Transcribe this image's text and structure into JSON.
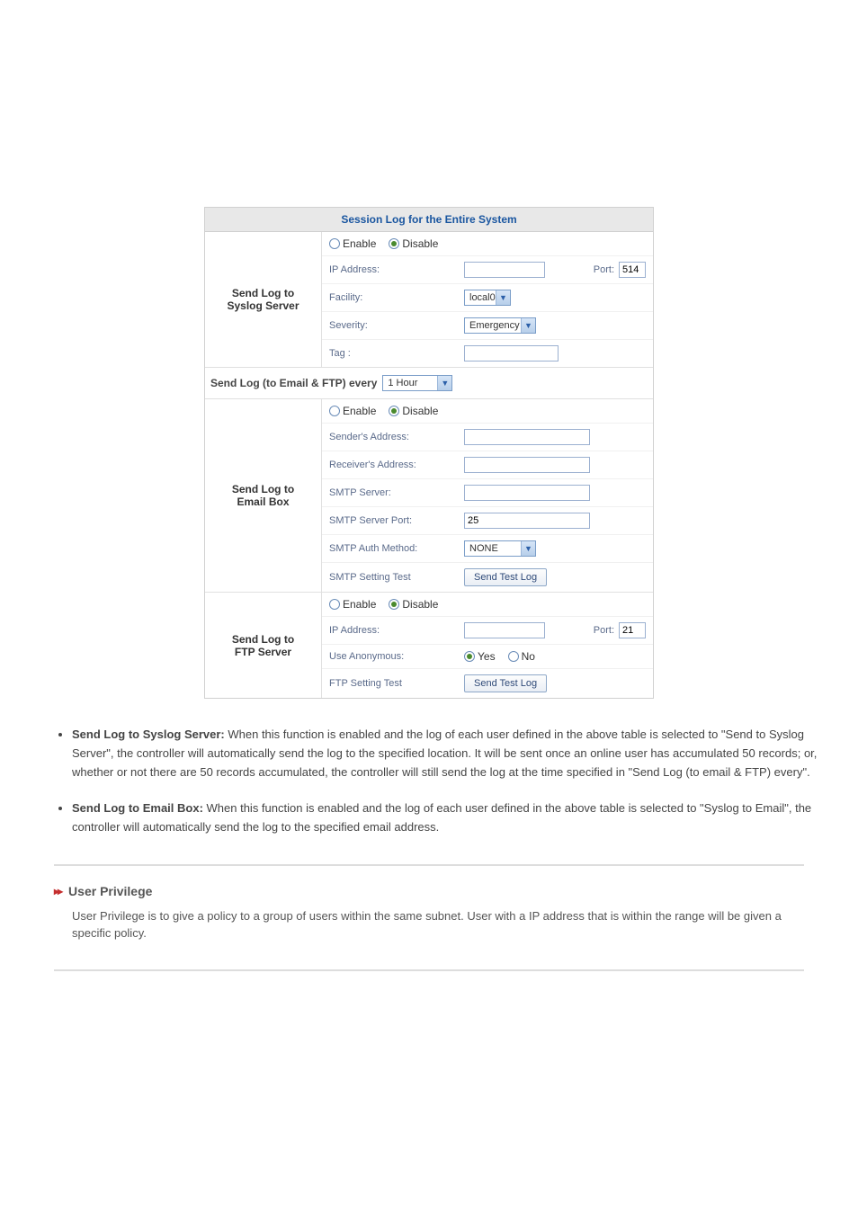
{
  "table_title": "Session Log for the Entire System",
  "radio": {
    "enable": "Enable",
    "disable": "Disable",
    "yes": "Yes",
    "no": "No"
  },
  "syslog": {
    "section_label": "Send Log to\nSyslog Server",
    "ip_label": "IP Address:",
    "ip_value": "",
    "port_label": "Port:",
    "port_value": "514",
    "facility_label": "Facility:",
    "facility_value": "local0",
    "severity_label": "Severity:",
    "severity_value": "Emergency",
    "tag_label": "Tag :",
    "tag_value": ""
  },
  "interval": {
    "label": "Send Log (to Email & FTP) every",
    "value": "1 Hour"
  },
  "email": {
    "section_label": "Send Log to\nEmail Box",
    "sender_label": "Sender's Address:",
    "sender_value": "",
    "receiver_label": "Receiver's Address:",
    "receiver_value": "",
    "smtp_server_label": "SMTP Server:",
    "smtp_server_value": "",
    "smtp_port_label": "SMTP Server Port:",
    "smtp_port_value": "25",
    "smtp_auth_label": "SMTP Auth Method:",
    "smtp_auth_value": "NONE",
    "smtp_test_label": "SMTP Setting Test",
    "smtp_test_btn": "Send Test Log"
  },
  "ftp": {
    "section_label": "Send Log to\nFTP Server",
    "ip_label": "IP Address:",
    "ip_value": "",
    "port_label": "Port:",
    "port_value": "21",
    "anon_label": "Use Anonymous:",
    "ftp_test_label": "FTP Setting Test",
    "ftp_test_btn": "Send Test Log"
  },
  "explain": {
    "item1_title": "Send Log to Syslog Server:",
    "item1_body": " When this function is enabled and the log of each user defined in the above table is selected to \"Send to Syslog Server\", the controller will automatically send the log to the specified location. It will be sent once an online user has accumulated 50 records; or, whether or not there are 50 records accumulated, the controller will still send the log at the time specified in \"Send Log (to email & FTP) every\".",
    "item2_title": "Send Log to Email Box:",
    "item2_body": " When this function is enabled and the log of each user defined in the above table is selected to \"Syslog to Email\", the controller will automatically send the log to the specified email address."
  },
  "next_section": {
    "title": "User Privilege",
    "desc": "User Privilege is to give a policy to a group of users within the same subnet. User with a IP address that is within the range will be given a specific policy."
  }
}
